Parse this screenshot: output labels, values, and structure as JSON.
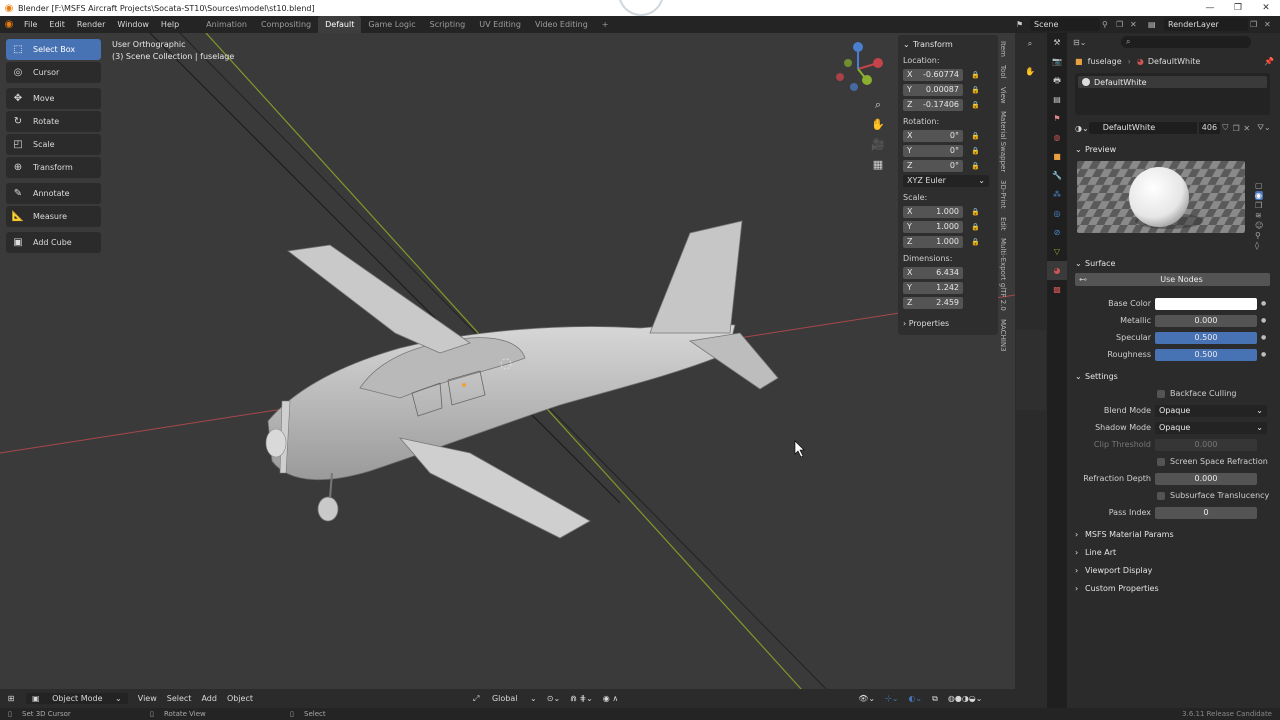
{
  "window": {
    "title": "Blender [F:\\MSFS Aircraft Projects\\Socata-ST10\\Sources\\model\\st10.blend]",
    "controls": [
      "—",
      "❐",
      "✕"
    ]
  },
  "menu": [
    "File",
    "Edit",
    "Render",
    "Window",
    "Help"
  ],
  "workspaces": [
    "Animation",
    "Compositing",
    "Default",
    "Game Logic",
    "Scripting",
    "UV Editing",
    "Video Editing",
    "+"
  ],
  "active_workspace": "Default",
  "scene": {
    "name": "Scene",
    "render_layer": "RenderLayer"
  },
  "viewport": {
    "view_name": "User Orthographic",
    "collection": "(3) Scene Collection | fuselage"
  },
  "tools": [
    {
      "label": "Select Box",
      "icon": "select-box-icon"
    },
    {
      "label": "Cursor",
      "icon": "cursor-icon"
    },
    {
      "label": "Move",
      "icon": "move-icon"
    },
    {
      "label": "Rotate",
      "icon": "rotate-icon"
    },
    {
      "label": "Scale",
      "icon": "scale-icon"
    },
    {
      "label": "Transform",
      "icon": "transform-icon"
    },
    {
      "label": "Annotate",
      "icon": "annotate-icon"
    },
    {
      "label": "Measure",
      "icon": "measure-icon"
    },
    {
      "label": "Add Cube",
      "icon": "add-cube-icon"
    }
  ],
  "transform": {
    "title": "Transform",
    "location_label": "Location:",
    "location": {
      "x": "-0.60774",
      "y": "0.00087",
      "z": "-0.17406"
    },
    "rotation_label": "Rotation:",
    "rotation": {
      "x": "0°",
      "y": "0°",
      "z": "0°"
    },
    "rotation_mode": "XYZ Euler",
    "scale_label": "Scale:",
    "scale": {
      "x": "1.000",
      "y": "1.000",
      "z": "1.000"
    },
    "dimensions_label": "Dimensions:",
    "dimensions": {
      "x": "6.434",
      "y": "1.242",
      "z": "2.459"
    },
    "axis": {
      "x": "X",
      "y": "Y",
      "z": "Z"
    },
    "properties_label": "Properties"
  },
  "sidebar_tabs": [
    "Item",
    "Tool",
    "View",
    "Material Swapper",
    "3D-Print",
    "Edit",
    "Multi-Export glTF 2.0",
    "MACHIN3"
  ],
  "viewport_header": {
    "mode": "Object Mode",
    "menus": [
      "View",
      "Select",
      "Add",
      "Object"
    ],
    "orientation": "Global"
  },
  "status_bar": {
    "left": "Set 3D Cursor",
    "middle": "Rotate View",
    "right": "Select",
    "version": "3.6.11 Release Candidate"
  },
  "properties": {
    "object_name": "fuselage",
    "material_name": "DefaultWhite",
    "slot": "DefaultWhite",
    "users": "406",
    "preview_label": "Preview",
    "surface_label": "Surface",
    "use_nodes_label": "Use Nodes",
    "base_color_label": "Base Color",
    "metallic_label": "Metallic",
    "metallic": "0.000",
    "specular_label": "Specular",
    "specular": "0.500",
    "specular_fraction": 0.5,
    "roughness_label": "Roughness",
    "roughness": "0.500",
    "roughness_fraction": 0.5,
    "settings_label": "Settings",
    "backface_culling": "Backface Culling",
    "blend_mode_label": "Blend Mode",
    "blend_mode": "Opaque",
    "shadow_mode_label": "Shadow Mode",
    "shadow_mode": "Opaque",
    "clip_threshold_label": "Clip Threshold",
    "clip_threshold": "0.000",
    "screen_space_refraction": "Screen Space Refraction",
    "refraction_depth_label": "Refraction Depth",
    "refraction_depth": "0.000",
    "subsurface_translucency": "Subsurface Translucency",
    "pass_index_label": "Pass Index",
    "pass_index": "0",
    "collapsed_panels": [
      "MSFS Material Params",
      "Line Art",
      "Viewport Display",
      "Custom Properties"
    ]
  },
  "colors": {
    "accent": "#4772b3",
    "viewport_bg": "#3a3a3a",
    "x_axis": "#c5434b",
    "y_axis": "#8ab02e",
    "blender_orange": "#e87d0d"
  }
}
